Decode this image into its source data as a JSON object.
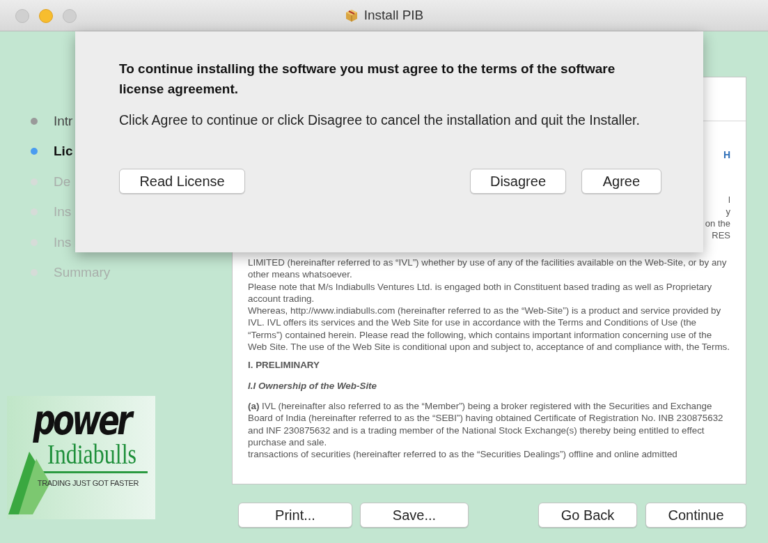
{
  "window": {
    "title": "Install PIB"
  },
  "steps": [
    {
      "label": "Intr",
      "selected": false,
      "completed": true
    },
    {
      "label": "Lic",
      "selected": true,
      "completed": false
    },
    {
      "label": "De",
      "selected": false,
      "completed": false
    },
    {
      "label": "Ins",
      "selected": false,
      "completed": false
    },
    {
      "label": "Ins",
      "selected": false,
      "completed": false
    },
    {
      "label": "Summary",
      "selected": false,
      "completed": false
    }
  ],
  "logo": {
    "wordmark": "power",
    "name": "Indiabulls",
    "tagline": "TRADING JUST GOT FASTER"
  },
  "document": {
    "fragments": [
      {
        "text": "H",
        "kind": "heading"
      },
      {
        "text": "l",
        "kind": "body"
      },
      {
        "text": "y",
        "kind": "body"
      },
      {
        "text": "on the",
        "kind": "body"
      },
      {
        "text": "RES",
        "kind": "body"
      }
    ],
    "blocks": [
      {
        "kind": "para",
        "text": "LIMITED (hereinafter referred to as “IVL”) whether by use of any of the facilities available on the Web-Site, or by any other means whatsoever."
      },
      {
        "kind": "para",
        "text": "Please note that M/s Indiabulls Ventures Ltd. is engaged both in Constituent based trading as well as Proprietary account trading."
      },
      {
        "kind": "para",
        "text": "Whereas, http://www.indiabulls.com (hereinafter referred to as the “Web-Site”) is a product and service provided by IVL. IVL offers its services and the Web Site for use in accordance with the Terms and Conditions of Use (the “Terms”) contained herein. Please read the following, which contains important information concerning use of the Web Site. The use of the Web Site is conditional upon and subject to, acceptance of and compliance with, the Terms."
      },
      {
        "kind": "heading",
        "text": "I. PRELIMINARY"
      },
      {
        "kind": "subheading",
        "text": "I.I Ownership of the Web-Site"
      },
      {
        "kind": "para",
        "text": "**(a)** IVL (hereinafter also referred to as the “Member”) being a broker registered with the Securities and Exchange Board of India (hereinafter referred to as the “SEBI”) having obtained Certificate of Registration No. INB 230875632 and INF 230875632 and is a trading member of the National Stock Exchange(s) thereby being entitled to effect purchase and sale."
      },
      {
        "kind": "para",
        "text": "transactions of securities (hereinafter referred to as the “Securities Dealings”) offline and online admitted"
      }
    ]
  },
  "buttons": [
    "Print...",
    "Save...",
    "Go Back",
    "Continue"
  ],
  "sheet": {
    "title": "To continue installing the software you must agree to the terms of the software license agreement.",
    "message": "Click Agree to continue or click Disagree to cancel the installation and quit the Installer.",
    "buttons": [
      "Read License",
      "Disagree",
      "Agree"
    ]
  }
}
